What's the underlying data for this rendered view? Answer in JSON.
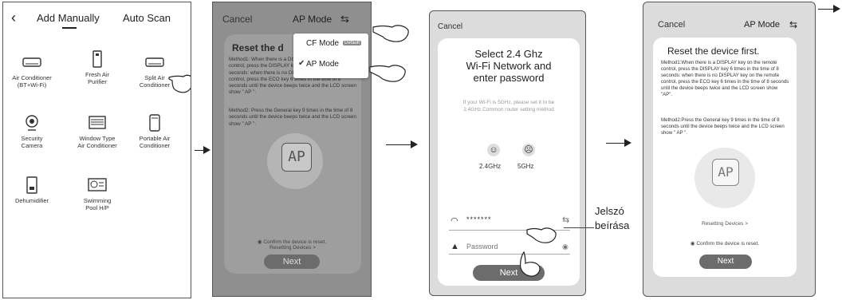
{
  "screen1": {
    "back_icon": "chevron-left-icon",
    "tab_manual": "Add Manually",
    "tab_auto": "Auto Scan",
    "devices": [
      {
        "label": "Air Conditioner\n(BT+Wi-Fi)",
        "icon": "air-conditioner-icon"
      },
      {
        "label": "Fresh Air\nPurifier",
        "icon": "fresh-air-purifier-icon"
      },
      {
        "label": "Split Air\nConditioner",
        "icon": "split-air-conditioner-icon"
      },
      {
        "label": "Security\nCamera",
        "icon": "security-camera-icon"
      },
      {
        "label": "Window Type\nAir Conditioner",
        "icon": "window-ac-icon"
      },
      {
        "label": "Portable Air\nConditioner",
        "icon": "portable-ac-icon"
      },
      {
        "label": "Dehumidifier",
        "icon": "dehumidifier-icon"
      },
      {
        "label": "Swimming\nPool H/P",
        "icon": "pool-heat-pump-icon"
      }
    ]
  },
  "screen2": {
    "cancel": "Cancel",
    "mode": "AP Mode",
    "title": "Reset the d",
    "method1": "Method1: When there is a DISPLAY key on the remote control, press the DISPLAY key 6 times in the time of 8 seconds: when there is no DISPLAY key on the remote control, press the ECO key 6 times in the time of 8 seconds until the device beeps twice and the LCD screen show \" AP \".",
    "method2": "Method2: Press the General key 9 times in the time of 8 seconds until the device beeps twice and the LCD screen show \" AP \".",
    "ap_display": "AP",
    "resetting": "Resetting Devices >",
    "confirm": "Confirm the device is reset.",
    "next": "Next",
    "dropdown": {
      "item1": "CF Mode",
      "item1_badge": "Default",
      "item2": "AP Mode"
    }
  },
  "screen3": {
    "cancel": "Cancel",
    "title": "Select 2.4 Ghz\nWi-Fi Network and\nenter password",
    "hint": "If your Wi-Fi is 5GHz, please set it to be 2.4GHz.Common router setting method",
    "freq_24": "2.4GHz",
    "freq_5": "5GHz",
    "ssid": "*******",
    "password_placeholder": "Password",
    "next": "Next"
  },
  "callout": {
    "text": "Jelszó\nbeírása"
  },
  "screen4": {
    "cancel": "Cancel",
    "mode": "AP Mode",
    "title": "Reset the device first.",
    "method1": "Method1:When there is a DISPLAY key on the remote control, press the DISPLAY key 6 times in the time of 8 seconds: when there is no DISPLAY key on the remote control, press the ECO key 6 times in the time of 8 seconds until the device beeps twice and the LCD screen show \"AP\".",
    "method2": "Method2:Press the General key 9 times in the time of 8 seconds until the device beeps twice and the LCD screen show \" AP \".",
    "ap_display": "AP",
    "resetting": "Resetting Devices >",
    "confirm": "Confirm the device is reset.",
    "next": "Next"
  }
}
